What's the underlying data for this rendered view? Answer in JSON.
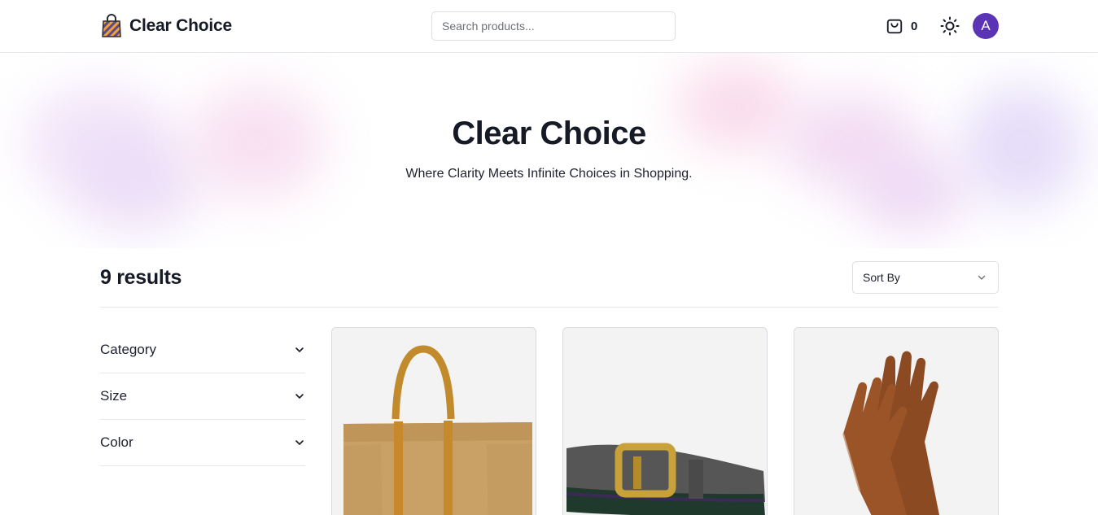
{
  "header": {
    "logo_text": "Clear Choice",
    "search_placeholder": "Search products...",
    "cart_count": "0",
    "avatar_letter": "A"
  },
  "hero": {
    "title": "Clear Choice",
    "subtitle": "Where Clarity Meets Infinite Choices in Shopping."
  },
  "results": {
    "count_label": "9 results",
    "sort_label": "Sort By"
  },
  "filters": [
    {
      "label": "Category"
    },
    {
      "label": "Size"
    },
    {
      "label": "Color"
    }
  ],
  "products": [
    {
      "image": "tote-bag-image"
    },
    {
      "image": "belt-image"
    },
    {
      "image": "gloves-image"
    }
  ],
  "colors": {
    "accent": "#5b34b6",
    "text": "#161a26",
    "border": "#e5e7eb"
  }
}
